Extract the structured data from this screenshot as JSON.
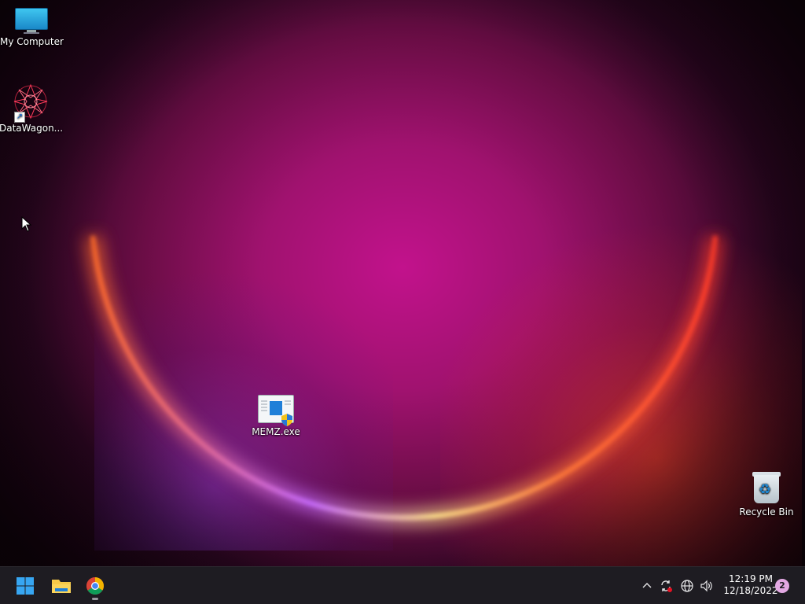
{
  "desktop": {
    "icons": [
      {
        "label": "My Computer",
        "icon": "computer-icon"
      },
      {
        "label": "DataWagon...",
        "icon": "datawagon-shortcut-icon"
      },
      {
        "label": "MEMZ.exe",
        "icon": "executable-icon"
      },
      {
        "label": "Recycle Bin",
        "icon": "recycle-bin-icon"
      }
    ]
  },
  "taskbar": {
    "apps": [
      {
        "name": "start",
        "icon": "windows-start-icon"
      },
      {
        "name": "file-explorer",
        "icon": "folder-icon"
      },
      {
        "name": "chrome",
        "icon": "chrome-icon",
        "running": true
      }
    ],
    "tray": {
      "icons": [
        "chevron-up-icon",
        "sync-icon",
        "network-icon",
        "volume-icon"
      ],
      "time": "12:19 PM",
      "date": "12/18/2022",
      "notifications": "2"
    }
  },
  "colors": {
    "taskbar": "#1e1c22",
    "wallpaper_center": "#c2128c",
    "accent": "#1f7fd8"
  }
}
